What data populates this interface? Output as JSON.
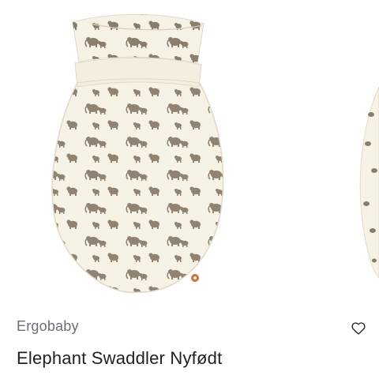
{
  "product": {
    "brand": "Ergobaby",
    "name": "Elephant Swaddler Nyfødt",
    "image_alt": "Elephant Swaddler Nyfødt",
    "wishlist_icon": "heart-outline-icon"
  },
  "colors": {
    "fabric": "#f6f2e6",
    "fabric_shadow": "#e6e0cf",
    "elephant": "#8b7d6b",
    "brand_text": "#6b6f78",
    "name_text": "#1e1f22"
  }
}
